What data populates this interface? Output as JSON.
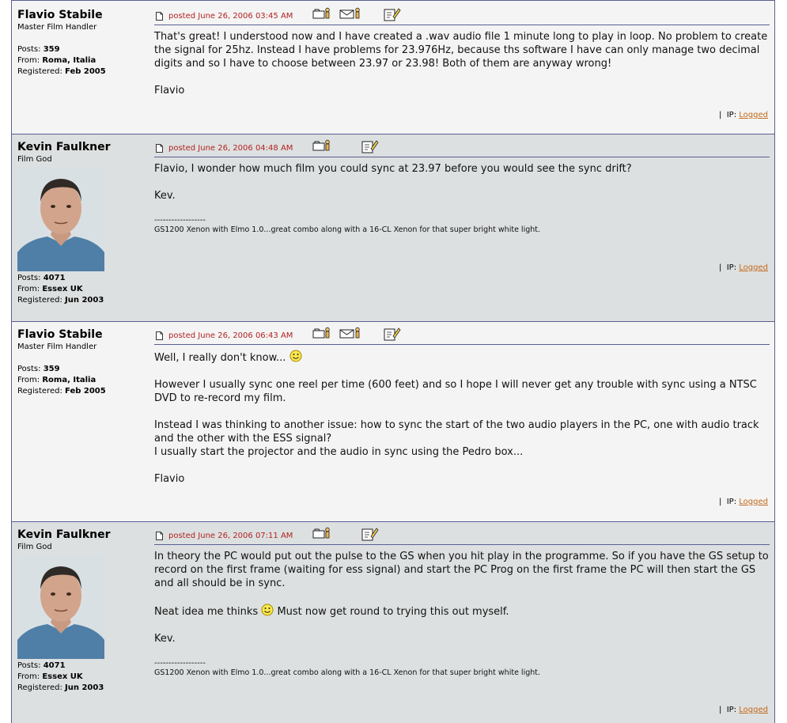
{
  "posts": [
    {
      "author": "Flavio Stabile",
      "rank": "Master Film Handler",
      "posts_label": "Posts:",
      "posts": "359",
      "from_label": "From:",
      "from": "Roma, Italia",
      "registered_label": "Registered:",
      "registered": "Feb 2005",
      "posted": "posted June 26, 2006 03:45 AM",
      "has_email": true,
      "paragraphs": [
        "That's great! I understood now and I have created a .wav audio file 1 minute long to play in loop. No problem to create the signal for 25hz. Instead I have problems for 23.976Hz, because ths software I have can only manage two decimal digits and so I have to choose between 23.97 or 23.98! Both of them are anyway wrong!",
        "Flavio"
      ],
      "ip_label": "IP:",
      "ip_link": "Logged"
    },
    {
      "author": "Kevin Faulkner",
      "rank": "Film God",
      "posts_label": "Posts:",
      "posts": "4071",
      "from_label": "From:",
      "from": "Essex UK",
      "registered_label": "Registered:",
      "registered": "Jun 2003",
      "posted": "posted June 26, 2006 04:48 AM",
      "has_email": false,
      "paragraphs": [
        "Flavio, I wonder how much film you could sync at 23.97 before you would see the sync drift?",
        "Kev."
      ],
      "sig_rule": "------------------",
      "signature": "GS1200 Xenon with Elmo 1.0...great combo along with a 16-CL Xenon for that super bright white light.",
      "ip_label": "IP:",
      "ip_link": "Logged"
    },
    {
      "author": "Flavio Stabile",
      "rank": "Master Film Handler",
      "posts_label": "Posts:",
      "posts": "359",
      "from_label": "From:",
      "from": "Roma, Italia",
      "registered_label": "Registered:",
      "registered": "Feb 2005",
      "posted": "posted June 26, 2006 06:43 AM",
      "has_email": true,
      "p1": "Well, I really don't know...",
      "p2": "However I usually sync one reel per time (600 feet) and so I hope I will never get any trouble with sync using a NTSC DVD to re-record my film.",
      "p3a": "Instead I was thinking to another issue: how to sync the start of the two audio players in the PC, one with audio track and the other with the ESS signal?",
      "p3b": "I usually start the projector and the audio in sync using the Pedro box...",
      "p4": "Flavio",
      "ip_label": "IP:",
      "ip_link": "Logged"
    },
    {
      "author": "Kevin Faulkner",
      "rank": "Film God",
      "posts_label": "Posts:",
      "posts": "4071",
      "from_label": "From:",
      "from": "Essex UK",
      "registered_label": "Registered:",
      "registered": "Jun 2003",
      "posted": "posted June 26, 2006 07:11 AM",
      "has_email": false,
      "p1": "In theory the PC would put out the pulse to the GS when you hit play in the programme. So if you have the GS setup to record on the first frame (waiting for ess signal) and start the PC Prog on the first frame the PC will then start the GS and all should be in sync.",
      "p2a": "Neat idea me thinks",
      "p2b": "Must now get round to trying this out myself.",
      "p3": "Kev.",
      "sig_rule": "------------------",
      "signature": "GS1200 Xenon with Elmo 1.0...great combo along with a 16-CL Xenon for that super bright white light.",
      "ip_label": "IP:",
      "ip_link": "Logged"
    }
  ],
  "colors": {
    "light_bg": "#f4f4f4",
    "dark_bg": "#dde0e0",
    "border": "#5a5f93",
    "date": "#b22222",
    "link": "#c2691a"
  }
}
